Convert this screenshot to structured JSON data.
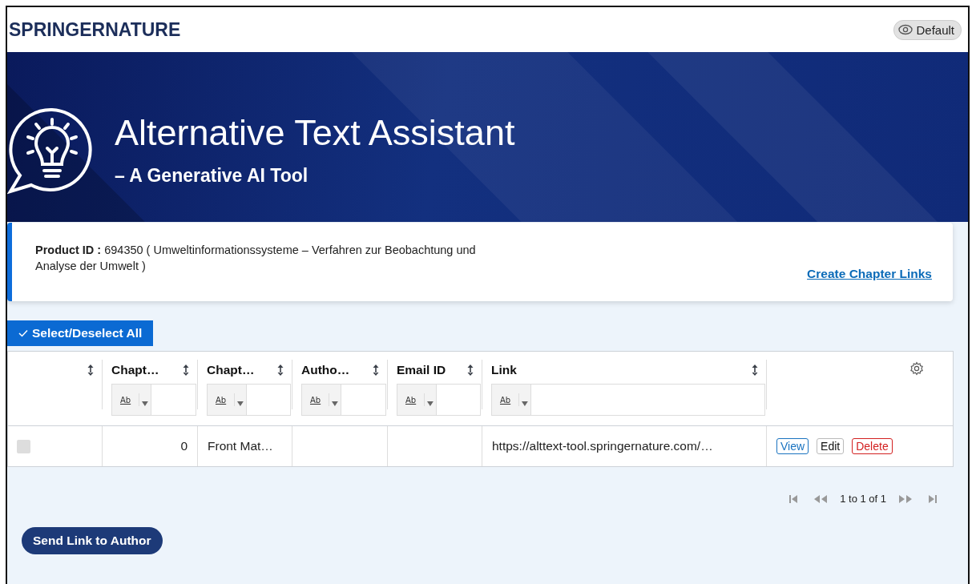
{
  "header": {
    "logo_parts": [
      "SPRINGER",
      "NATURE"
    ],
    "theme_button": "Default"
  },
  "banner": {
    "title": "Alternative Text Assistant",
    "subtitle": "– A Generative AI Tool"
  },
  "product": {
    "text": "**Product ID :**    694350 ( Umweltinformationssysteme – Verfahren zur Beobachtung und Analyse der Umwelt )",
    "link": "Create Chapter Links"
  },
  "select_all": "Select/Deselect All",
  "table": {
    "columns": [
      {},
      {
        "label": "Chapt…",
        "filter": "Ab"
      },
      {
        "label": "Chapt…",
        "filter": "Ab"
      },
      {
        "label": "Autho…",
        "filter": "Ab"
      },
      {
        "label": "Email ID",
        "filter": "Ab"
      },
      {
        "label": "Link",
        "filter": "Ab"
      }
    ],
    "rows": [
      {
        "checked": false,
        "cells": [
          "",
          "0",
          "Front Mat…",
          "",
          "",
          "https://alttext-tool.springernature.com/…"
        ],
        "actions": [
          {
            "label": "View",
            "kind": "view"
          },
          {
            "label": "Edit",
            "kind": "edit"
          },
          {
            "label": "Delete",
            "kind": "delete"
          }
        ]
      }
    ]
  },
  "pagination": {
    "summary": "1 to 1 of 1"
  },
  "send_button": "Send Link to Author"
}
